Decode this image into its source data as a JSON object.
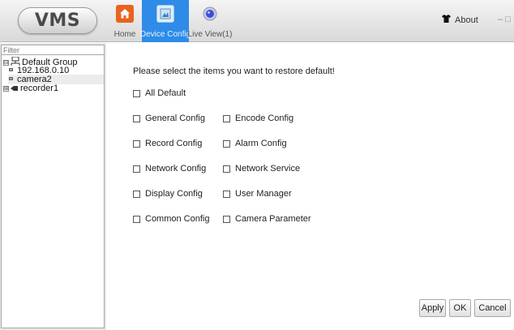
{
  "app": {
    "logo": "VMS"
  },
  "nav": {
    "tabs": [
      {
        "label": "Home",
        "active": false
      },
      {
        "label": "Device Config",
        "active": true
      },
      {
        "label": "Live View(1)",
        "active": false
      }
    ],
    "about_label": "About",
    "window_controls": "– □"
  },
  "sidebar": {
    "filter_placeholder": "Filter",
    "tree": {
      "group": {
        "expander": "⊟",
        "label": "Default Group"
      },
      "device": "192.168.0.10",
      "camera": "camera2",
      "recorder": {
        "expander": "⊞",
        "label": "recorder1"
      }
    }
  },
  "main": {
    "prompt": "Please select the items you want to restore default!",
    "options": {
      "all_default": "All Default",
      "general_config": "General Config",
      "encode_config": "Encode Config",
      "record_config": "Record Config",
      "alarm_config": "Alarm Config",
      "network_config": "Network Config",
      "network_service": "Network Service",
      "display_config": "Display Config",
      "user_manager": "User Manager",
      "common_config": "Common Config",
      "camera_parameter": "Camera Parameter"
    },
    "buttons": {
      "apply": "Apply",
      "ok": "OK",
      "cancel": "Cancel"
    }
  },
  "colors": {
    "active_tab": "#2e8be8",
    "home_icon": "#e8641e",
    "live_icon": "#3a4fd0"
  },
  "icons": [
    "home-icon",
    "device-config-icon",
    "live-view-icon",
    "shirt-icon",
    "network-group-icon",
    "camera-icon",
    "recorder-icon"
  ]
}
